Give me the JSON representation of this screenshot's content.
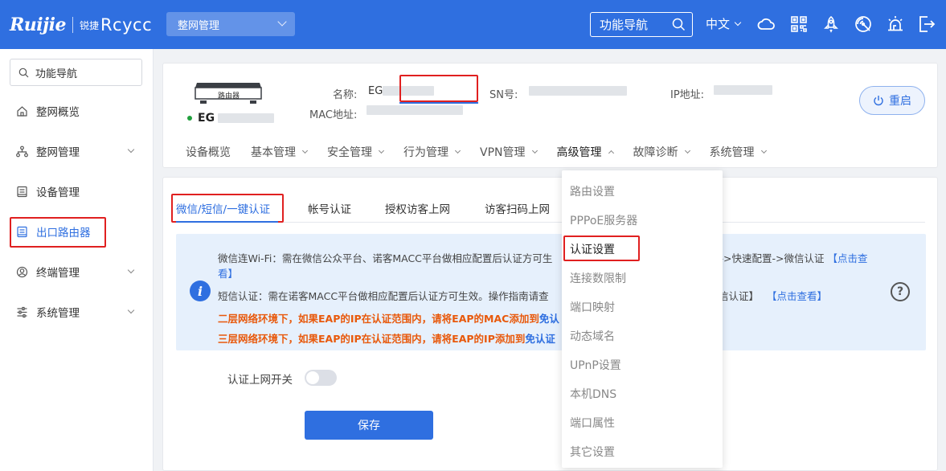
{
  "header": {
    "brand_ruijie": "Ruijie",
    "brand_reyee_mark": "锐捷",
    "brand_reyee": "Rcycc",
    "network_select": "整网管理",
    "search_label": "功能导航",
    "language": "中文",
    "bar_color": "#2f6fe0",
    "icons": [
      "cloud-icon",
      "qr-code-icon",
      "rocket-icon",
      "network-scan-icon",
      "alarm-icon",
      "logout-icon"
    ]
  },
  "sidebar": {
    "search_label": "功能导航",
    "items": [
      {
        "label": "整网概览",
        "icon": "home-icon"
      },
      {
        "label": "整网管理",
        "icon": "topology-icon"
      },
      {
        "label": "设备管理",
        "icon": "device-list-icon"
      },
      {
        "label": "出口路由器",
        "icon": "router-icon"
      },
      {
        "label": "终端管理",
        "icon": "user-circle-icon"
      },
      {
        "label": "系统管理",
        "icon": "sliders-icon"
      }
    ]
  },
  "device": {
    "image_label": "路由器",
    "name_prefix": "EG",
    "name_label": "名称:",
    "name_value_prefix": "EG",
    "sn_label": "SN号:",
    "ip_label": "IP地址:",
    "mac_label": "MAC地址:",
    "reboot_label": "重启",
    "status_color": "#21a03d"
  },
  "main_nav": [
    {
      "label": "设备概览"
    },
    {
      "label": "基本管理"
    },
    {
      "label": "安全管理"
    },
    {
      "label": "行为管理"
    },
    {
      "label": "VPN管理"
    },
    {
      "label": "高级管理"
    },
    {
      "label": "故障诊断"
    },
    {
      "label": "系统管理"
    }
  ],
  "sub_tabs": [
    {
      "label": "微信/短信/一键认证"
    },
    {
      "label": "帐号认证"
    },
    {
      "label": "授权访客上网"
    },
    {
      "label": "访客扫码上网"
    }
  ],
  "notice": {
    "line1_text": "微信连Wi-Fi：需在微信公众平台、诺客MACC平台做相应配置后认证方可生",
    "line1_tail": "》->快速配置->微信认证",
    "line1_link": "【点击查",
    "line1_link_cont": "看】",
    "line2_text": "短信认证：需在诺客MACC平台做相应配置后认证方可生效。操作指南请查",
    "line2_tail": "信认证】",
    "line2_link": "【点击查看】",
    "warn1_text": "二层网络环境下，如果EAP的IP在认证范围内，请将EAP的MAC添加到",
    "warn1_link": "免认",
    "warn2_text": "三层网络环境下，如果EAP的IP在认证范围内，请将EAP的IP添加到",
    "warn2_link": "免认证"
  },
  "form": {
    "toggle_label": "认证上网开关",
    "toggle_on": false,
    "save_label": "保存"
  },
  "dropdown": {
    "items": [
      {
        "label": "路由设置"
      },
      {
        "label": "PPPoE服务器"
      },
      {
        "label": "认证设置"
      },
      {
        "label": "连接数限制"
      },
      {
        "label": "端口映射"
      },
      {
        "label": "动态域名"
      },
      {
        "label": "UPnP设置"
      },
      {
        "label": "本机DNS"
      },
      {
        "label": "端口属性"
      },
      {
        "label": "其它设置"
      }
    ]
  }
}
